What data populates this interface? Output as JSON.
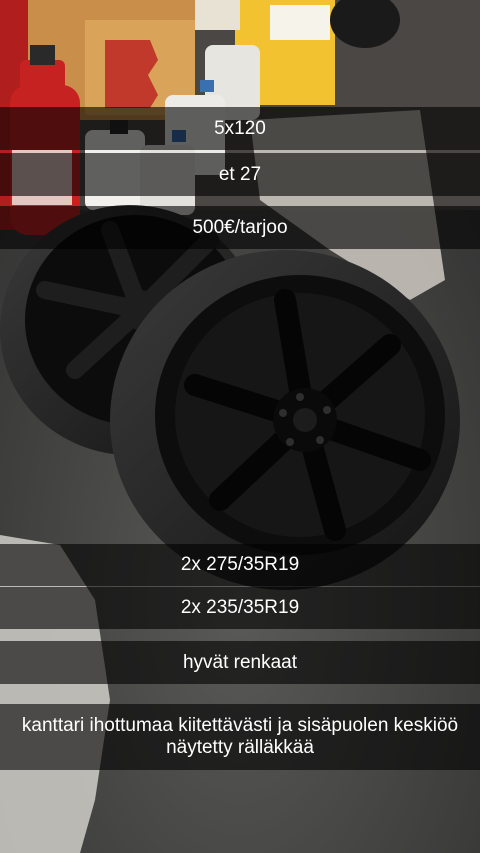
{
  "captions": [
    "5x120",
    "et 27",
    "500€/tarjoo",
    "2x 275/35R19",
    "2x 235/35R19",
    "hyvät renkaat",
    "kanttari ihottumaa kiitettävästi ja sisäpuolen keskiöö näytetty rälläkkää"
  ],
  "colors": {
    "caption_background": "rgba(0,0,0,0.6)",
    "caption_text": "#ffffff"
  }
}
